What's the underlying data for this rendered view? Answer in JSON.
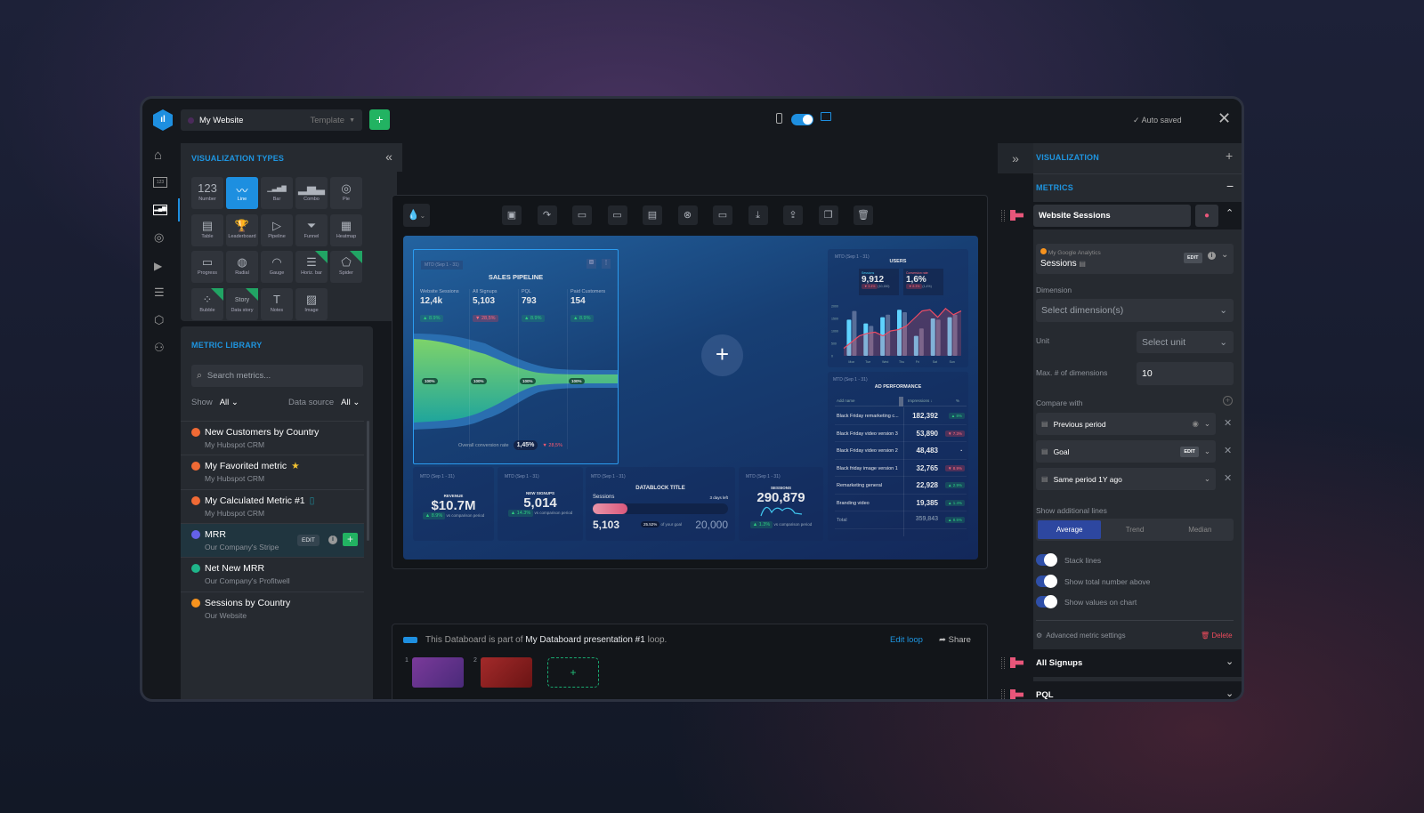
{
  "topbar": {
    "dashboard_name": "My Website",
    "template_label": "Template",
    "auto_saved": "Auto saved"
  },
  "viz_panel": {
    "title": "VISUALIZATION TYPES",
    "types": [
      {
        "label": "Number",
        "glyph": "123",
        "selected": false,
        "new": false
      },
      {
        "label": "Line",
        "glyph": "〰",
        "selected": true,
        "new": false
      },
      {
        "label": "Bar",
        "glyph": "▁▃▅▇",
        "selected": false,
        "new": false
      },
      {
        "label": "Combo",
        "glyph": "▂▅▃",
        "selected": false,
        "new": false
      },
      {
        "label": "Pie",
        "glyph": "◎",
        "selected": false,
        "new": false
      },
      {
        "label": "Table",
        "glyph": "▤",
        "selected": false,
        "new": false
      },
      {
        "label": "Leaderboard",
        "glyph": "🏆",
        "selected": false,
        "new": false
      },
      {
        "label": "Pipeline",
        "glyph": "▷",
        "selected": false,
        "new": false
      },
      {
        "label": "Funnel",
        "glyph": "⏷",
        "selected": false,
        "new": false
      },
      {
        "label": "Heatmap",
        "glyph": "▦",
        "selected": false,
        "new": false
      },
      {
        "label": "Progress",
        "glyph": "▭",
        "selected": false,
        "new": false
      },
      {
        "label": "Radial",
        "glyph": "◍",
        "selected": false,
        "new": false
      },
      {
        "label": "Gauge",
        "glyph": "◠",
        "selected": false,
        "new": false
      },
      {
        "label": "Horiz. bar",
        "glyph": "☰",
        "selected": false,
        "new": true
      },
      {
        "label": "Spider",
        "glyph": "⬠",
        "selected": false,
        "new": true
      },
      {
        "label": "Bubble",
        "glyph": "⁘",
        "selected": false,
        "new": true
      },
      {
        "label": "Data story",
        "glyph": "Story",
        "selected": false,
        "new": true
      },
      {
        "label": "Notes",
        "glyph": "T",
        "selected": false,
        "new": false
      },
      {
        "label": "Image",
        "glyph": "▨",
        "selected": false,
        "new": false
      }
    ]
  },
  "metric_library": {
    "title": "METRIC LIBRARY",
    "search_placeholder": "Search metrics...",
    "show_label": "Show",
    "show_value": "All",
    "source_label": "Data source",
    "source_value": "All",
    "edit": "EDIT",
    "items": [
      {
        "name": "New Customers by Country",
        "source": "My Hubspot CRM",
        "color": "#f06a35",
        "icon": "hubspot-icon",
        "badge": ""
      },
      {
        "name": "My Favorited metric",
        "source": "My Hubspot CRM",
        "color": "#f06a35",
        "icon": "hubspot-icon",
        "badge": "★"
      },
      {
        "name": "My Calculated Metric #1",
        "source": "My Hubspot CRM",
        "color": "#f06a35",
        "icon": "hubspot-icon",
        "badge": "▯"
      },
      {
        "name": "MRR",
        "source": "Our Company's Stripe",
        "color": "#6461e8",
        "icon": "stripe-icon",
        "badge": ""
      },
      {
        "name": "Net New MRR",
        "source": "Our Company's Profitwell",
        "color": "#1fb58a",
        "icon": "profitwell-icon",
        "badge": ""
      },
      {
        "name": "Sessions by Country",
        "source": "Our Website",
        "color": "#f7931e",
        "icon": "google-analytics-icon",
        "badge": ""
      }
    ]
  },
  "dashboard": {
    "pipeline": {
      "date": "MTD (Sep 1 - 31)",
      "title": "SALES PIPELINE",
      "stages": [
        {
          "label": "Website Sessions",
          "value": "12,4k",
          "change": "▲ 8.9%",
          "up": true
        },
        {
          "label": "All Signups",
          "value": "5,103",
          "change": "▼ 28,5%",
          "up": false
        },
        {
          "label": "PQL",
          "value": "793",
          "change": "▲ 8.9%",
          "up": true
        },
        {
          "label": "Paid Customers",
          "value": "154",
          "change": "▲ 8.9%",
          "up": true
        }
      ],
      "pct": "100%",
      "conv_label": "Overall conversion rate",
      "conv_value": "1,45%",
      "conv_change": "▼ 28,5%"
    },
    "users": {
      "date": "MTD (Sep 1 - 31)",
      "title": "USERS",
      "kpis": [
        {
          "label": "Sessions",
          "value": "9,912",
          "change": "▼ 3.4%",
          "prev": "(10,150)"
        },
        {
          "label": "Conversion rate",
          "value": "1,6%",
          "change": "▼ 8.3%",
          "prev": "(1,4%)"
        }
      ],
      "chart_data": {
        "type": "bar",
        "categories": [
          "Mon",
          "Tue",
          "Wed",
          "Thu",
          "Fri",
          "Sat",
          "Sun"
        ],
        "yticks": [
          "2000",
          "1500",
          "1000",
          "500",
          "0"
        ],
        "ylim": [
          0,
          2000
        ],
        "series": [
          {
            "values": [
              1450,
              1300,
              1550,
              1850,
              800,
              1500,
              1550
            ]
          },
          {
            "values": [
              1800,
              1200,
              1650,
              1750,
              1100,
              1450,
              1650
            ]
          }
        ],
        "line": [
          300,
          550,
          800,
          900,
          950,
          800,
          1000,
          1050,
          1200,
          1500,
          1800,
          1850,
          1550,
          1900,
          1650,
          1800
        ]
      }
    },
    "ad": {
      "date": "MTD (Sep 1 - 31)",
      "title": "AD PERFORMANCE",
      "col1": "Add name",
      "col2": "Impressions ↓",
      "col3": "%",
      "rows": [
        {
          "name": "Black Friday remarketing c...",
          "value": "182,392",
          "pct": "▲ 8%",
          "up": true
        },
        {
          "name": "Black Friday video version 3",
          "value": "53,890",
          "pct": "▼ 7.3%",
          "up": false
        },
        {
          "name": "Black Friday video version 2",
          "value": "48,483",
          "pct": "•",
          "up": null
        },
        {
          "name": "Black friday image version 1",
          "value": "32,765",
          "pct": "▼ 8.9%",
          "up": false
        },
        {
          "name": "Remarketing general",
          "value": "22,928",
          "pct": "▲ 2.9%",
          "up": true
        },
        {
          "name": "Branding video",
          "value": "19,385",
          "pct": "▲ 1.4%",
          "up": true
        },
        {
          "name": "Total",
          "value": "359,843",
          "pct": "▲ 8.5%",
          "up": true
        }
      ]
    },
    "revenue": {
      "date": "MTD (Sep 1 - 31)",
      "title": "REVENUE",
      "value": "$10.7M",
      "change": "▲ 8.9%",
      "vs": "vs comparison period"
    },
    "signups": {
      "date": "MTD (Sep 1 - 31)",
      "title": "NEW SIGNUPS",
      "value": "5,014",
      "change": "▲ 14.3%",
      "vs": "vs comparison period"
    },
    "datablock": {
      "date": "MTD (Sep 1 - 31)",
      "title": "DATABLOCK TITLE",
      "metric": "Sessions",
      "days_left": "3 days left",
      "value": "5,103",
      "goal_pct": "25.52%",
      "goal_label": "of your goal",
      "goal": "20,000",
      "progress": 25.52
    },
    "sessions": {
      "date": "MTD (Sep 1 - 31)",
      "title": "SESSIONS",
      "value": "290,879",
      "change": "▲ 1.3%",
      "vs": "vs comparison period"
    }
  },
  "loop": {
    "prefix": "This Databoard is part of",
    "name": "My Databoard presentation #1",
    "suffix": "loop.",
    "edit": "Edit loop",
    "share": "Share",
    "slides": [
      "1",
      "2"
    ]
  },
  "right": {
    "visualization": "VISUALIZATION",
    "metrics": "METRICS",
    "metric_name": "Website Sessions",
    "source": "My Google Analytics",
    "metric": "Sessions",
    "edit": "EDIT",
    "dimension_label": "Dimension",
    "dimension_placeholder": "Select dimension(s)",
    "unit_label": "Unit",
    "unit_placeholder": "Select unit",
    "max_label": "Max. # of dimensions",
    "max_value": "10",
    "compare_label": "Compare with",
    "compare": [
      "Previous period",
      "Goal",
      "Same period 1Y ago"
    ],
    "lines_label": "Show additional lines",
    "lines_tabs": [
      "Average",
      "Trend",
      "Median"
    ],
    "lines_selected": "Average",
    "toggles": [
      {
        "label": "Stack lines",
        "on": true
      },
      {
        "label": "Show total number above",
        "on": true
      },
      {
        "label": "Show values on chart",
        "on": true
      }
    ],
    "advanced": "Advanced metric settings",
    "delete": "Delete",
    "other_metrics": [
      "All Signups",
      "PQL"
    ]
  }
}
